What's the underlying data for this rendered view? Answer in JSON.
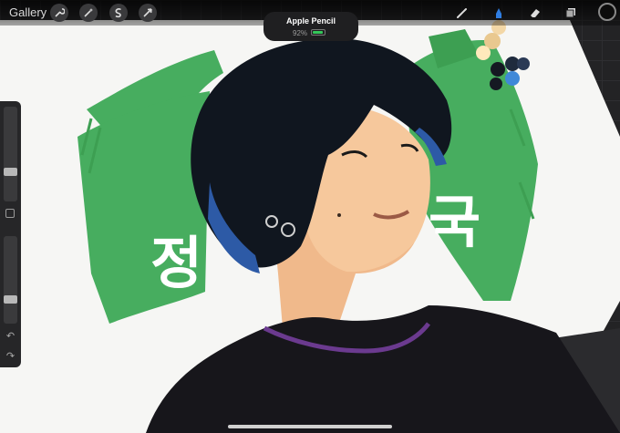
{
  "topbar": {
    "gallery_label": "Gallery",
    "tools_left": [
      "wrench-icon",
      "magic-wand-icon",
      "selection-icon",
      "transform-icon"
    ],
    "tools_right": [
      "brush-icon",
      "smudge-icon",
      "eraser-icon",
      "layers-icon"
    ],
    "active_tool": "smudge-icon",
    "current_color": "#0c0c0c"
  },
  "pencil_popup": {
    "title": "Apple Pencil",
    "battery_text": "92%",
    "battery_level": 0.92,
    "battery_color": "#34c759"
  },
  "sidebar": {
    "brush_size_level": 0.3,
    "opacity_level": 0.25
  },
  "artwork": {
    "korean_left": "정",
    "korean_right": "국",
    "palette_colors": [
      "#f3d7a6",
      "#e9c88f",
      "#ffe9bb",
      "#151922",
      "#1f2b3d",
      "#2a3a55",
      "#3f88d8"
    ],
    "background_green": "#47ad5f"
  }
}
